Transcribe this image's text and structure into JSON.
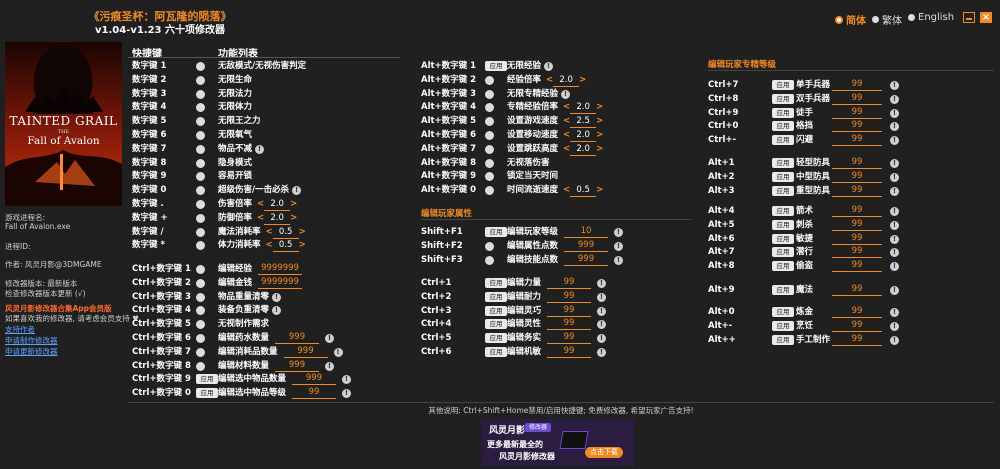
{
  "app": {
    "title": "《污痕圣杯：阿瓦隆的陨落》",
    "subtitle": "v1.04-v1.23 六十项修改器"
  },
  "lang": {
    "options": [
      "简体",
      "繁体",
      "English"
    ],
    "selected": "简体"
  },
  "colors": {
    "accent": "#f08a24",
    "background": "#202020",
    "link": "#5aa0ff"
  },
  "icons": {
    "toggle": "circle-toggle",
    "info": "info-circle",
    "minimize": "minimize-icon",
    "close": "close-icon"
  },
  "cover": {
    "line1": "TAINTED GRAIL",
    "line2": "THE",
    "line3": "Fall of Avalon"
  },
  "sidebar": {
    "proc_label": "游戏进程名:",
    "proc_name": "Fall of Avalon.exe",
    "pid_label": "进程ID:",
    "author": "作者: 风灵月影@3DMGAME",
    "trainer_ver": "修改器版本: 最新版本",
    "check_update": "检查修改器版本更新 (√)",
    "promo": "风灵月影修改器合集App会员版",
    "like_text": "如果喜欢我的修改器, 请考虑会员支持",
    "link_support": "支持作者",
    "link_request": "申请制作修改器",
    "link_update": "申请更新修改器"
  },
  "headers": {
    "hotkey": "快捷键",
    "function": "功能列表"
  },
  "apply_label": "应用",
  "col1": [
    {
      "key": "数字键 1",
      "label": "无敌模式/无视伤害判定"
    },
    {
      "key": "数字键 2",
      "label": "无限生命"
    },
    {
      "key": "数字键 3",
      "label": "无限法力"
    },
    {
      "key": "数字键 4",
      "label": "无限体力"
    },
    {
      "key": "数字键 5",
      "label": "无限王之力"
    },
    {
      "key": "数字键 6",
      "label": "无限氧气"
    },
    {
      "key": "数字键 7",
      "label": "物品不减",
      "info": "!"
    },
    {
      "key": "数字键 8",
      "label": "隐身模式"
    },
    {
      "key": "数字键 9",
      "label": "容易开锁"
    },
    {
      "key": "数字键 0",
      "label": "超级伤害/一击必杀",
      "info": "!"
    },
    {
      "key": "数字键 .",
      "label": "伤害倍率",
      "spin": "2.0"
    },
    {
      "key": "数字键 +",
      "label": "防御倍率",
      "spin": "2.0"
    },
    {
      "key": "数字键 /",
      "label": "魔法消耗率",
      "spin": "0.5"
    },
    {
      "key": "数字键 *",
      "label": "体力消耗率",
      "spin": "0.5"
    }
  ],
  "col1b": [
    {
      "key": "Ctrl+数字键 1",
      "label": "编辑经验",
      "value": "9999999"
    },
    {
      "key": "Ctrl+数字键 2",
      "label": "编辑金钱",
      "value": "9999999"
    },
    {
      "key": "Ctrl+数字键 3",
      "label": "物品重量清零",
      "info": "!"
    },
    {
      "key": "Ctrl+数字键 4",
      "label": "装备负重清零",
      "info": "!"
    },
    {
      "key": "Ctrl+数字键 5",
      "label": "无视制作需求"
    },
    {
      "key": "Ctrl+数字键 6",
      "label": "编辑药水数量",
      "value": "999",
      "info": "!"
    },
    {
      "key": "Ctrl+数字键 7",
      "label": "编辑消耗品数量",
      "value": "999",
      "info": "!"
    },
    {
      "key": "Ctrl+数字键 8",
      "label": "编辑材料数量",
      "value": "999",
      "info": "!"
    },
    {
      "key": "Ctrl+数字键 9",
      "label": "编辑选中物品数量",
      "value": "999",
      "info": "!",
      "apply": true
    },
    {
      "key": "Ctrl+数字键 0",
      "label": "编辑选中物品等级",
      "value": "99",
      "info": "!",
      "apply": true
    }
  ],
  "col2": [
    {
      "key": "Alt+数字键 1",
      "label": "无限经验",
      "info": "!",
      "apply": true
    },
    {
      "key": "Alt+数字键 2",
      "label": "经验倍率",
      "spin": "2.0"
    },
    {
      "key": "Alt+数字键 3",
      "label": "无限专精经验",
      "info": "!"
    },
    {
      "key": "Alt+数字键 4",
      "label": "专精经验倍率",
      "spin": "2.0"
    },
    {
      "key": "Alt+数字键 5",
      "label": "设置游戏速度",
      "spin": "2.5"
    },
    {
      "key": "Alt+数字键 6",
      "label": "设置移动速度",
      "spin": "2.0"
    },
    {
      "key": "Alt+数字键 7",
      "label": "设置跳跃高度",
      "spin": "2.0"
    },
    {
      "key": "Alt+数字键 8",
      "label": "无视落伤害"
    },
    {
      "key": "Alt+数字键 9",
      "label": "锁定当天时间"
    },
    {
      "key": "Alt+数字键 0",
      "label": "时间流逝速度",
      "spin": "0.5"
    }
  ],
  "col2_sec1": "编辑玩家属性",
  "col2b": [
    {
      "key": "Shift+F1",
      "label": "编辑玩家等级",
      "value": "10",
      "info": "!",
      "apply": true
    },
    {
      "key": "Shift+F2",
      "label": "编辑属性点数",
      "value": "999",
      "info": "!"
    },
    {
      "key": "Shift+F3",
      "label": "编辑技能点数",
      "value": "999",
      "info": "!"
    }
  ],
  "col2c": [
    {
      "key": "Ctrl+1",
      "label": "编辑力量",
      "value": "99",
      "info": "!",
      "apply": true
    },
    {
      "key": "Ctrl+2",
      "label": "编辑耐力",
      "value": "99",
      "info": "!",
      "apply": true
    },
    {
      "key": "Ctrl+3",
      "label": "编辑灵巧",
      "value": "99",
      "info": "!",
      "apply": true
    },
    {
      "key": "Ctrl+4",
      "label": "编辑灵性",
      "value": "99",
      "info": "!",
      "apply": true
    },
    {
      "key": "Ctrl+5",
      "label": "编辑务实",
      "value": "99",
      "info": "!",
      "apply": true
    },
    {
      "key": "Ctrl+6",
      "label": "编辑机敏",
      "value": "99",
      "info": "!",
      "apply": true
    }
  ],
  "col3_sec": "编辑玩家专精等级",
  "col3": [
    {
      "key": "Ctrl+7",
      "label": "单手兵器",
      "value": "99",
      "info": "!",
      "apply": true,
      "group": 0
    },
    {
      "key": "Ctrl+8",
      "label": "双手兵器",
      "value": "99",
      "info": "!",
      "apply": true,
      "group": 0
    },
    {
      "key": "Ctrl+9",
      "label": "徒手",
      "value": "99",
      "info": "!",
      "apply": true,
      "group": 0
    },
    {
      "key": "Ctrl+0",
      "label": "格挡",
      "value": "99",
      "info": "!",
      "apply": true,
      "group": 0
    },
    {
      "key": "Ctrl+-",
      "label": "闪避",
      "value": "99",
      "info": "!",
      "apply": true,
      "group": 0
    },
    {
      "key": "Alt+1",
      "label": "轻型防具",
      "value": "99",
      "info": "!",
      "apply": true,
      "group": 1
    },
    {
      "key": "Alt+2",
      "label": "中型防具",
      "value": "99",
      "info": "!",
      "apply": true,
      "group": 1
    },
    {
      "key": "Alt+3",
      "label": "重型防具",
      "value": "99",
      "info": "!",
      "apply": true,
      "group": 1
    },
    {
      "key": "Alt+4",
      "label": "箭术",
      "value": "99",
      "info": "!",
      "apply": true,
      "group": 2
    },
    {
      "key": "Alt+5",
      "label": "刺杀",
      "value": "99",
      "info": "!",
      "apply": true,
      "group": 2
    },
    {
      "key": "Alt+6",
      "label": "敏捷",
      "value": "99",
      "info": "!",
      "apply": true,
      "group": 2
    },
    {
      "key": "Alt+7",
      "label": "潜行",
      "value": "99",
      "info": "!",
      "apply": true,
      "group": 2
    },
    {
      "key": "Alt+8",
      "label": "偷盗",
      "value": "99",
      "info": "!",
      "apply": true,
      "group": 2
    },
    {
      "key": "Alt+9",
      "label": "魔法",
      "value": "99",
      "info": "!",
      "apply": true,
      "group": 3
    },
    {
      "key": "Alt+0",
      "label": "炼金",
      "value": "99",
      "info": "!",
      "apply": true,
      "group": 4
    },
    {
      "key": "Alt+-",
      "label": "烹饪",
      "value": "99",
      "info": "!",
      "apply": true,
      "group": 4
    },
    {
      "key": "Alt++",
      "label": "手工制作",
      "value": "99",
      "info": "!",
      "apply": true,
      "group": 4
    }
  ],
  "footer": {
    "note": "其他说明: Ctrl+Shift+Home禁用/启用快捷键; 免费修改器, 希望玩家广告支持!"
  },
  "ad": {
    "logo": "风灵月影",
    "badge": "修改器",
    "line1": "更多最新最全的",
    "line2": "风灵月影修改器",
    "button": "点击下载"
  }
}
